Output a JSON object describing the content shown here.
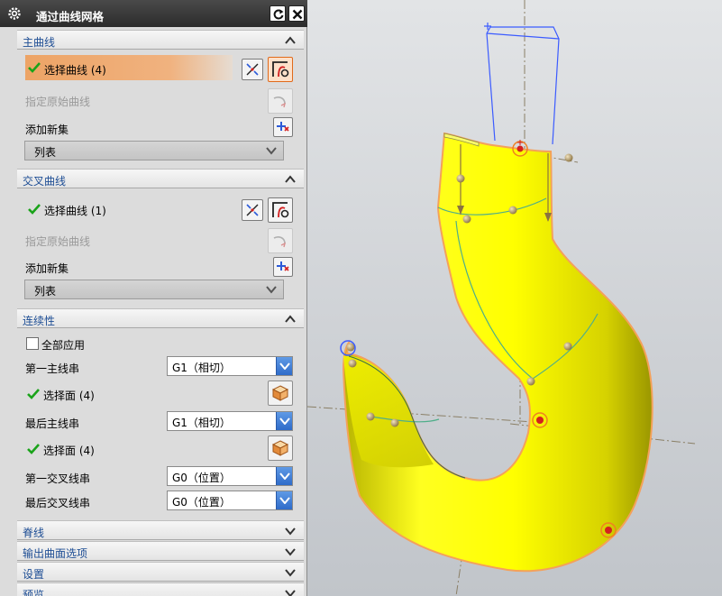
{
  "dialog": {
    "title": "通过曲线网格",
    "icons": {
      "settings": "gear-icon",
      "reset": "reset-icon",
      "close": "close-icon"
    }
  },
  "primary_curves": {
    "header": "主曲线",
    "select_label": "选择曲线 (4)",
    "specify_origin_label": "指定原始曲线",
    "add_new_set_label": "添加新集",
    "list_label": "列表"
  },
  "cross_curves": {
    "header": "交叉曲线",
    "select_label": "选择曲线 (1)",
    "specify_origin_label": "指定原始曲线",
    "add_new_set_label": "添加新集",
    "list_label": "列表"
  },
  "continuity": {
    "header": "连续性",
    "apply_all_label": "全部应用",
    "apply_all_checked": false,
    "first_primary_label": "第一主线串",
    "first_primary_value": "G1（相切）",
    "first_primary_faces": "选择面 (4)",
    "last_primary_label": "最后主线串",
    "last_primary_value": "G1（相切）",
    "last_primary_faces": "选择面 (4)",
    "first_cross_label": "第一交叉线串",
    "first_cross_value": "G0（位置）",
    "last_cross_label": "最后交叉线串",
    "last_cross_value": "G0（位置）"
  },
  "collapsed_sections": {
    "spine": "脊线",
    "output_surface_options": "输出曲面选项",
    "settings": "设置",
    "preview": "预览"
  },
  "colors": {
    "accent_orange": "#e06a1b",
    "section_header_text": "#1d4d94",
    "check_green": "#1aa31a",
    "hook_yellow": "#ffff00",
    "hook_edge_orange": "#f4a15a",
    "blue_wireframe": "#3b5bff"
  }
}
